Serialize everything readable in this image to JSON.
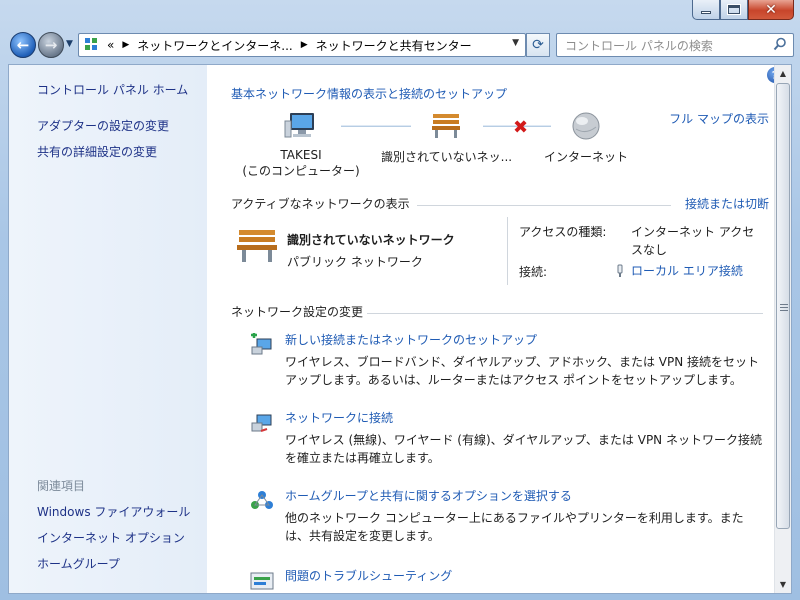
{
  "window": {
    "controls": {
      "minimize": "minimize-icon",
      "maximize": "maximize-icon",
      "close": "close-icon"
    }
  },
  "navbar": {
    "breadcrumb_prefix": "«",
    "breadcrumbs": [
      "ネットワークとインターネ...",
      "ネットワークと共有センター"
    ],
    "search_placeholder": "コントロール パネルの検索"
  },
  "sidebar": {
    "home": "コントロール パネル ホーム",
    "links": [
      "アダプターの設定の変更",
      "共有の詳細設定の変更"
    ],
    "related_header": "関連項目",
    "related": [
      "Windows ファイアウォール",
      "インターネット オプション",
      "ホームグループ"
    ]
  },
  "main": {
    "title": "基本ネットワーク情報の表示と接続のセットアップ",
    "full_map": "フル マップの表示",
    "map": {
      "computer_name": "TAKESI",
      "computer_sub": "(このコンピューター)",
      "network": "識別されていないネッ...",
      "internet": "インターネット"
    },
    "active_header": "アクティブなネットワークの表示",
    "connect_disconnect": "接続または切断",
    "active_network": {
      "name": "識別されていないネットワーク",
      "type": "パブリック ネットワーク",
      "access_label": "アクセスの種類:",
      "access_value_1": "インターネット アクセ",
      "access_value_2": "スなし",
      "connection_label": "接続:",
      "connection_value": "ローカル エリア接続"
    },
    "change_header": "ネットワーク設定の変更",
    "tasks": [
      {
        "title": "新しい接続またはネットワークのセットアップ",
        "desc": "ワイヤレス、ブロードバンド、ダイヤルアップ、アドホック、または VPN 接続をセットアップします。あるいは、ルーターまたはアクセス ポイントをセットアップします。"
      },
      {
        "title": "ネットワークに接続",
        "desc": "ワイヤレス (無線)、ワイヤード (有線)、ダイヤルアップ、または VPN ネットワーク接続を確立または再確立します。"
      },
      {
        "title": "ホームグループと共有に関するオプションを選択する",
        "desc": "他のネットワーク コンピューター上にあるファイルやプリンターを利用します。または、共有設定を変更します。"
      },
      {
        "title": "問題のトラブルシューティング",
        "desc": ""
      }
    ]
  },
  "colors": {
    "link": "#1f5bb4",
    "sidebar_bg": "#e8f0f9",
    "accent": "#1f5bb4"
  }
}
